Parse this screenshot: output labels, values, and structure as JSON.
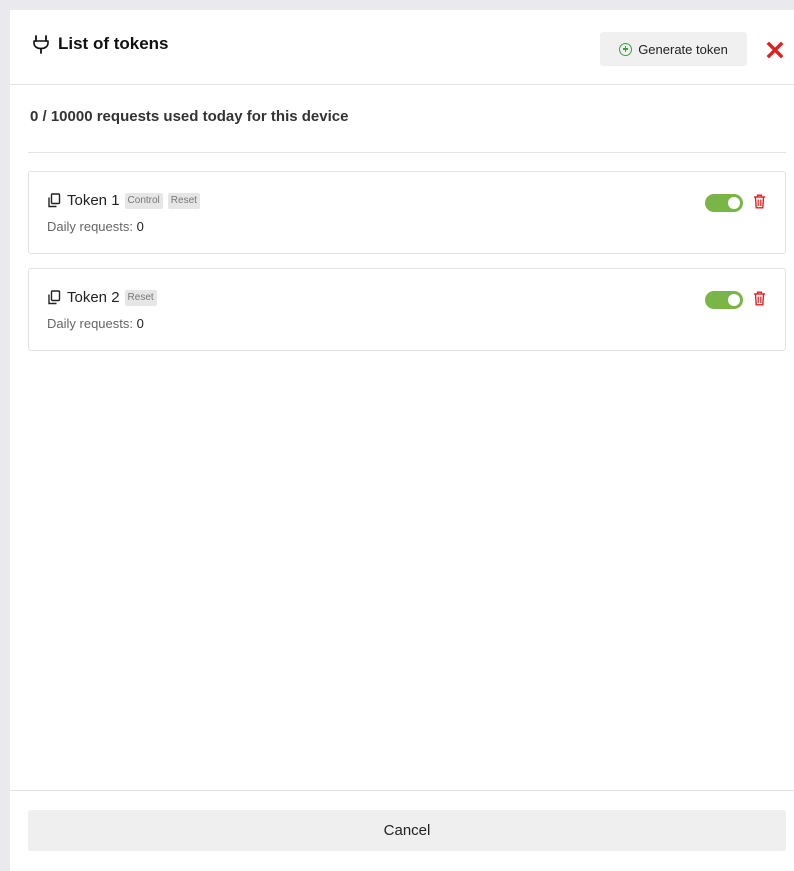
{
  "header": {
    "title": "List of tokens",
    "generate_label": "Generate token",
    "plug_icon": "plug-icon",
    "close_icon": "close-icon"
  },
  "usage": {
    "text": "0 / 10000 requests used today for this device"
  },
  "tokens": [
    {
      "name": "Token 1",
      "badges": [
        "Control",
        "Reset"
      ],
      "daily_label": "Daily requests:",
      "daily_value": "0",
      "enabled": true
    },
    {
      "name": "Token 2",
      "badges": [
        "Reset"
      ],
      "daily_label": "Daily requests:",
      "daily_value": "0",
      "enabled": true
    }
  ],
  "footer": {
    "cancel_label": "Cancel"
  },
  "colors": {
    "accent_green": "#7ab547",
    "danger_red": "#e02020",
    "plus_green": "#3aa33a"
  }
}
